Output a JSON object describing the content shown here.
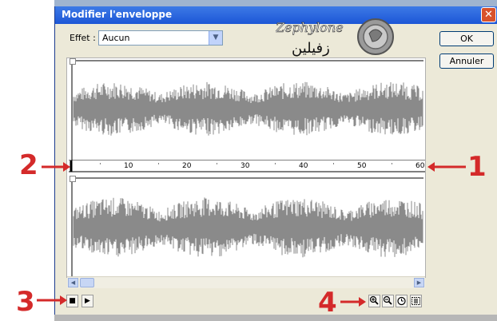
{
  "dialog": {
    "title": "Modifier l'enveloppe",
    "close_label": "✕"
  },
  "effect": {
    "label": "Effet :",
    "value": "Aucun"
  },
  "buttons": {
    "ok": "OK",
    "reset": "Annuler"
  },
  "watermark": {
    "latin": "Zephylone",
    "arabic": "زفيلين"
  },
  "timeline": {
    "ticks": [
      "10",
      "20",
      "30",
      "40",
      "50",
      "60"
    ]
  },
  "annotations": [
    "1",
    "2",
    "3",
    "4"
  ],
  "colors": {
    "waveform": "#8a8a8a",
    "annotation": "#d42a2a",
    "title_bar": "#1c56d6"
  },
  "icons": {
    "stop": "stop-icon",
    "play": "play-icon",
    "zoom_in": "zoom-in-icon",
    "zoom_out": "zoom-out-icon",
    "time": "clock-icon",
    "full": "zoom-full-icon"
  }
}
